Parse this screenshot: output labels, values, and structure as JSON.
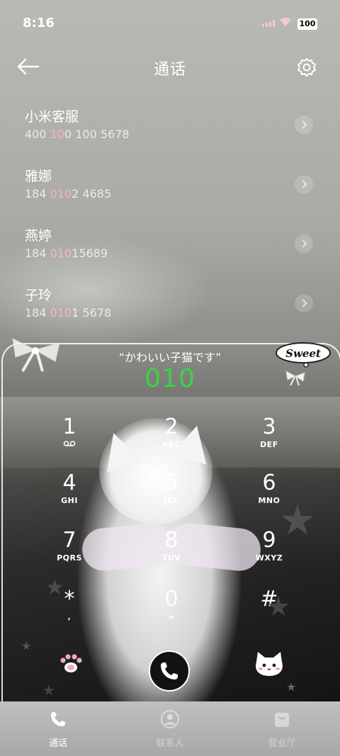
{
  "status_bar": {
    "time": "8:16",
    "battery": "100"
  },
  "header": {
    "title": "通话"
  },
  "calls": [
    {
      "name": "小米客服",
      "num_pre": "400 ",
      "num_hl": "10",
      "num_post": "0 100 5678"
    },
    {
      "name": "雅娜",
      "num_pre": "184 ",
      "num_hl": "010",
      "num_post": "2 4685"
    },
    {
      "name": "燕婷",
      "num_pre": "184 ",
      "num_hl": "010",
      "num_post": "15689"
    },
    {
      "name": "子玲",
      "num_pre": "184 ",
      "num_hl": "010",
      "num_post": "1 5678"
    }
  ],
  "dialer": {
    "quote": "“かわいい子猫です”",
    "input": "010",
    "sticker": "Sweet",
    "keys": [
      {
        "digit": "1",
        "letters": ""
      },
      {
        "digit": "2",
        "letters": "ABC"
      },
      {
        "digit": "3",
        "letters": "DEF"
      },
      {
        "digit": "4",
        "letters": "GHI"
      },
      {
        "digit": "5",
        "letters": "JKL"
      },
      {
        "digit": "6",
        "letters": "MNO"
      },
      {
        "digit": "7",
        "letters": "PQRS"
      },
      {
        "digit": "8",
        "letters": "TUV"
      },
      {
        "digit": "9",
        "letters": "WXYZ"
      },
      {
        "digit": "*",
        "letters": ","
      },
      {
        "digit": "0",
        "letters": "+"
      },
      {
        "digit": "#",
        "letters": ""
      }
    ]
  },
  "nav": {
    "items": [
      {
        "label": "通话",
        "active": true
      },
      {
        "label": "联系人",
        "active": false
      },
      {
        "label": "营业厅",
        "active": false
      }
    ]
  },
  "colors": {
    "accent_green": "#3bd24a",
    "highlight_pink": "#f2b6c6"
  }
}
